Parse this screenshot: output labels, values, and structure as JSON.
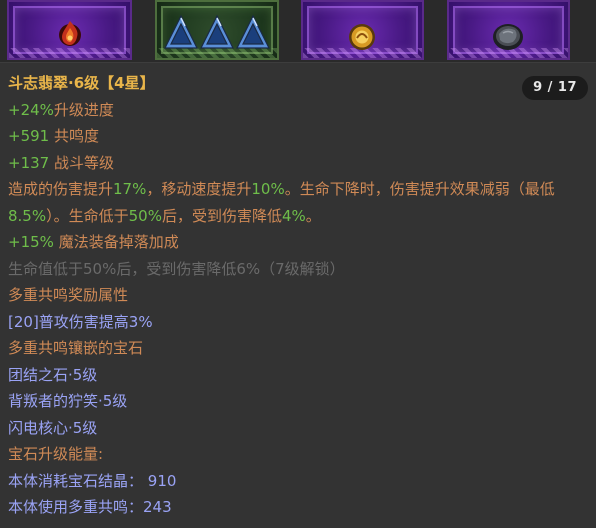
{
  "slots": [
    {
      "name": "purple-slot-red-gem",
      "icon": "red-flame-gem-icon"
    },
    {
      "name": "green-slot-three-blue-gems",
      "icon": "blue-triangle-gems-icon"
    },
    {
      "name": "purple-slot-gold-gem",
      "icon": "gold-orb-gem-icon"
    },
    {
      "name": "purple-slot-dark-gem",
      "icon": "dark-stone-gem-icon"
    }
  ],
  "tooltip": {
    "page_indicator": "9 / 17",
    "title": "斗志翡翠·6级【4星】",
    "upgrade_progress": {
      "value": "+24%",
      "label": "升级进度"
    },
    "resonance": {
      "value": "+591",
      "label": " 共鸣度"
    },
    "combat_level": {
      "value": "+137",
      "label": " 战斗等级"
    },
    "effect": {
      "p1": "造成的伤害提升",
      "v1": "17%",
      "p2": "，移动速度提升",
      "v2": "10%",
      "p3": "。生命下降时，伤害提升效果减弱（最低",
      "v3": "8.5%",
      "p4": "）。生命低于",
      "v4": "50%",
      "p5": "后，受到伤害降低",
      "v5": "4%",
      "p6": "。"
    },
    "magic_drop": {
      "value": "+15%",
      "label": " 魔法装备掉落加成"
    },
    "locked_effect": "生命值低于50%后，受到伤害降低6%（7级解锁）",
    "multi_resonance_header": "多重共鸣奖励属性",
    "multi_resonance_bonus": "[20]普攻伤害提高3%",
    "inlaid_header": "多重共鸣镶嵌的宝石",
    "inlaid_gems": [
      "团结之石·5级",
      "背叛者的狞笑·5级",
      "闪电核心·5级"
    ],
    "upgrade_energy_label": "宝石升级能量:",
    "cost_crystal": {
      "label": "本体消耗宝石结晶：",
      "value": "910"
    },
    "cost_resonance": {
      "label": "本体使用多重共鸣：",
      "value": "243"
    }
  },
  "colors": {
    "title": "#e9b54a",
    "positive": "#6fbe4a",
    "neutral": "#d08a56",
    "locked": "#6a6a6a",
    "resonance": "#9aa3f5",
    "panel_bg": "#333333",
    "slot_purple": "#4a1a86"
  }
}
